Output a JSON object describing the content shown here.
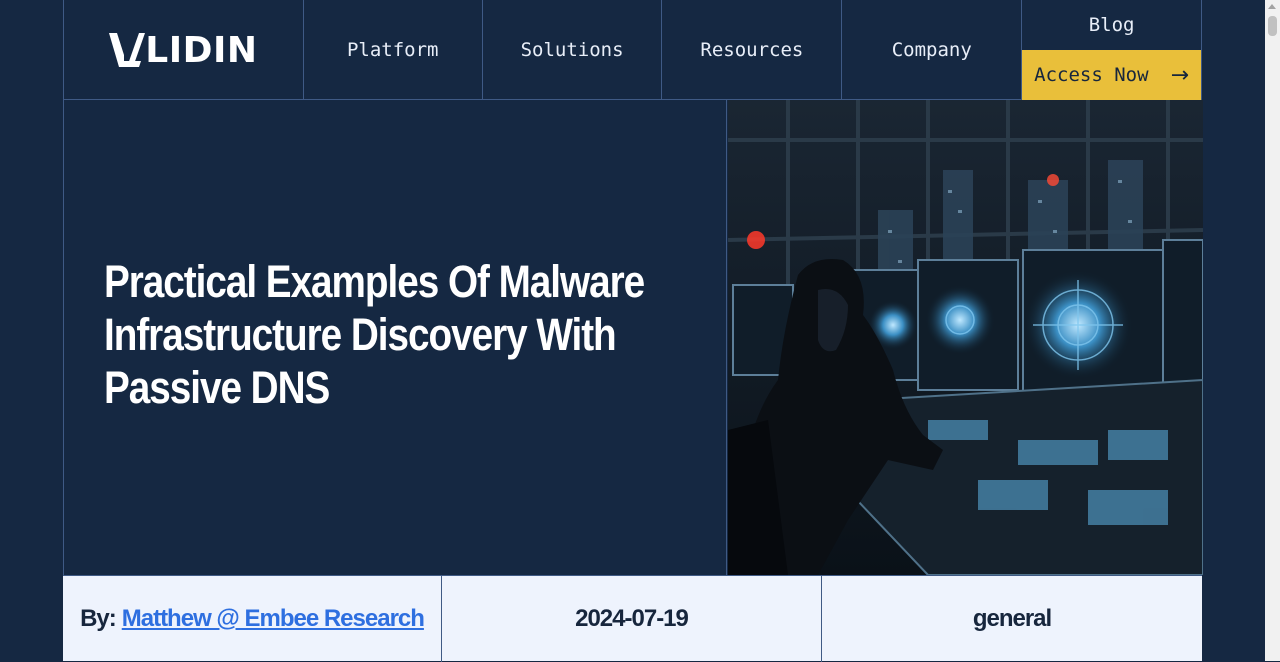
{
  "header": {
    "logo_text": "LIDIN",
    "logo_mark": "V/A",
    "nav": [
      "Platform",
      "Solutions",
      "Resources",
      "Company"
    ],
    "blog_label": "Blog",
    "cta_label": "Access Now",
    "cta_icon": "arrow-right-icon"
  },
  "hero": {
    "title": "Practical Examples Of Malware Infrastructure Discovery With Passive DNS",
    "image": "hooded-hacker-control-room-illustration"
  },
  "meta": {
    "by_label": "By:",
    "author": "Matthew @ Embee Research",
    "date": "2024-07-19",
    "category": "general"
  },
  "colors": {
    "background": "#152842",
    "accent": "#e9bf3a",
    "link": "#2e6fe0",
    "meta_bg": "#eef3fd"
  }
}
